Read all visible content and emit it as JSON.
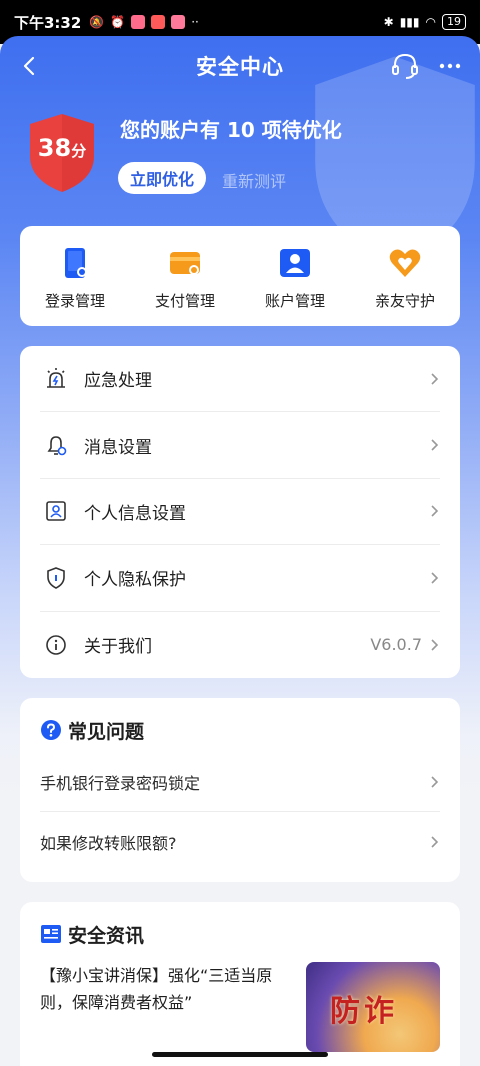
{
  "status_bar": {
    "time": "下午3:32",
    "battery": "19"
  },
  "nav": {
    "title": "安全中心"
  },
  "score": {
    "value": "38",
    "unit": "分",
    "message": "您的账户有 10 项待优化",
    "optimize_label": "立即优化",
    "retest_label": "重新测评"
  },
  "quick_actions": [
    {
      "label": "登录管理",
      "icon": "login-manage-icon",
      "color": "#1e5bf5"
    },
    {
      "label": "支付管理",
      "icon": "payment-manage-icon",
      "color": "#f59a1b"
    },
    {
      "label": "账户管理",
      "icon": "account-manage-icon",
      "color": "#1e5bf5"
    },
    {
      "label": "亲友守护",
      "icon": "family-guard-icon",
      "color": "#f59a1b"
    }
  ],
  "menu": [
    {
      "label": "应急处理",
      "icon": "emergency-icon",
      "value": ""
    },
    {
      "label": "消息设置",
      "icon": "bell-settings-icon",
      "value": ""
    },
    {
      "label": "个人信息设置",
      "icon": "profile-icon",
      "value": ""
    },
    {
      "label": "个人隐私保护",
      "icon": "privacy-shield-icon",
      "value": ""
    },
    {
      "label": "关于我们",
      "icon": "info-icon",
      "value": "V6.0.7"
    }
  ],
  "faq": {
    "title": "常见问题",
    "items": [
      {
        "text": "手机银行登录密码锁定"
      },
      {
        "text": "如果修改转账限额?"
      }
    ]
  },
  "news": {
    "title": "安全资讯",
    "headline": "【豫小宝讲消保】强化“三适当原则，保障消费者权益”",
    "thumb_text": "防诈"
  },
  "colors": {
    "primary": "#3f6ff0",
    "badge_red": "#e8413e",
    "accent_orange": "#f59a1b"
  }
}
